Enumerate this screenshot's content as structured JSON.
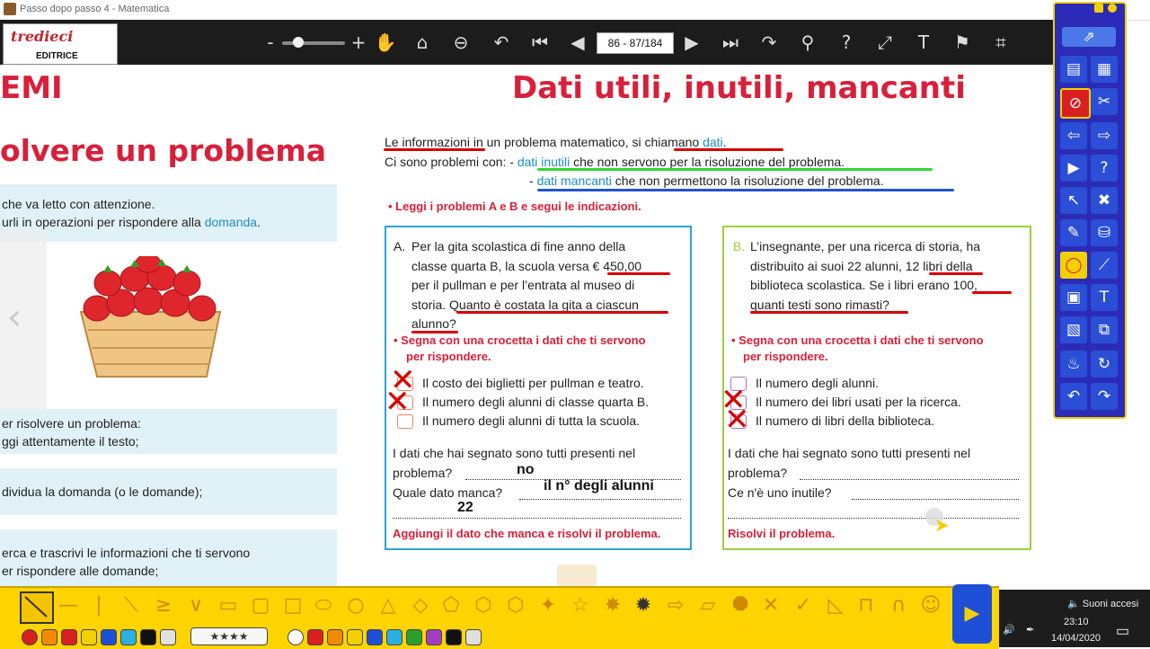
{
  "window": {
    "title": "Passo dopo passo 4 - Matematica"
  },
  "logo": {
    "brand": "tredieci",
    "sub": "EDITRICE"
  },
  "toolbar": {
    "page_field": "86 - 87/184",
    "zoom_minus": "-",
    "zoom_plus": "+"
  },
  "left_page": {
    "title_partial": "EMI",
    "subtitle_partial": "olvere un problema",
    "intro_line1": "che va letto con attenzione.",
    "intro_line2_a": "urli in operazioni per rispondere alla ",
    "intro_line2_b": "domanda",
    "intro_line2_c": ".",
    "steps": [
      {
        "line1": "er risolvere un problema:",
        "line2": "ggi attentamente il testo;"
      },
      {
        "line1": "dividua la domanda (o le domande);",
        "line2": ""
      },
      {
        "line1": "erca e trascrivi le informazioni che ti servono",
        "line2": "er rispondere alle domande;"
      }
    ]
  },
  "right_page": {
    "title": "Dati utili, inutili, mancanti",
    "intro1_a": "Le informazioni",
    "intro1_b": " in un problema matematico, ",
    "intro1_c": "si chiamano ",
    "intro1_d": "dati",
    "intro1_e": ".",
    "intro2_a": "Ci sono problemi con: - ",
    "intro2_b": "dati inutili",
    "intro2_c": " che non servono per la risoluzione del problema.",
    "intro3_a": "- ",
    "intro3_b": "dati mancanti",
    "intro3_c": " che non permettono la risoluzione del problema.",
    "instruction": "Leggi i problemi A e B e segui le indicazioni.",
    "problem_a": {
      "letter": "A.",
      "lines": [
        "Per la gita scolastica di fine anno della",
        "classe quarta B, la scuola versa € 450,00",
        "per il pullman e per l’entrata al museo di",
        "storia. Quanto è costata la gita a ciascun",
        "alunno?"
      ],
      "bullet_line1": "Segna con una crocetta i dati che ti servono",
      "bullet_line2": "per rispondere.",
      "options": [
        "Il costo dei biglietti per pullman e teatro.",
        "Il numero degli alunni di classe quarta B.",
        "Il numero degli alunni di tutta la scuola."
      ],
      "q1_line1": "I dati che hai segnato sono tutti presenti nel",
      "q1_line2": "problema?",
      "q2": "Quale dato manca?",
      "answer1": "no",
      "answer2": "il n° degli alunni",
      "answer3": "22",
      "footer": "Aggiungi il dato che manca e risolvi il problema."
    },
    "problem_b": {
      "letter": "B.",
      "lines": [
        "L’insegnante, per una ricerca di storia, ha",
        "distribuito ai suoi 22 alunni, 12 libri della",
        "biblioteca scolastica. Se i libri erano 100,",
        "quanti testi sono rimasti?"
      ],
      "bullet_line1": "Segna con una crocetta i dati che ti servono",
      "bullet_line2": "per rispondere.",
      "options": [
        "Il numero degli alunni.",
        "Il numero dei libri usati per la ricerca.",
        "Il numero di libri della biblioteca."
      ],
      "q1_line1": "I dati che hai segnato sono tutti presenti nel",
      "q1_line2": "problema?",
      "q2": "Ce n'è uno inutile?",
      "footer": "Risolvi il problema."
    }
  },
  "taskbar": {
    "label": "Suoni accesi",
    "time": "23:10",
    "date": "14/04/2020"
  },
  "colors": {
    "accent_red": "#d8203a",
    "accent_blue": "#1a8fc0",
    "box_a": "#2aa6d6",
    "box_b": "#9fcf3a",
    "tray": "#ffd400",
    "palette": "#2b2bb8"
  }
}
